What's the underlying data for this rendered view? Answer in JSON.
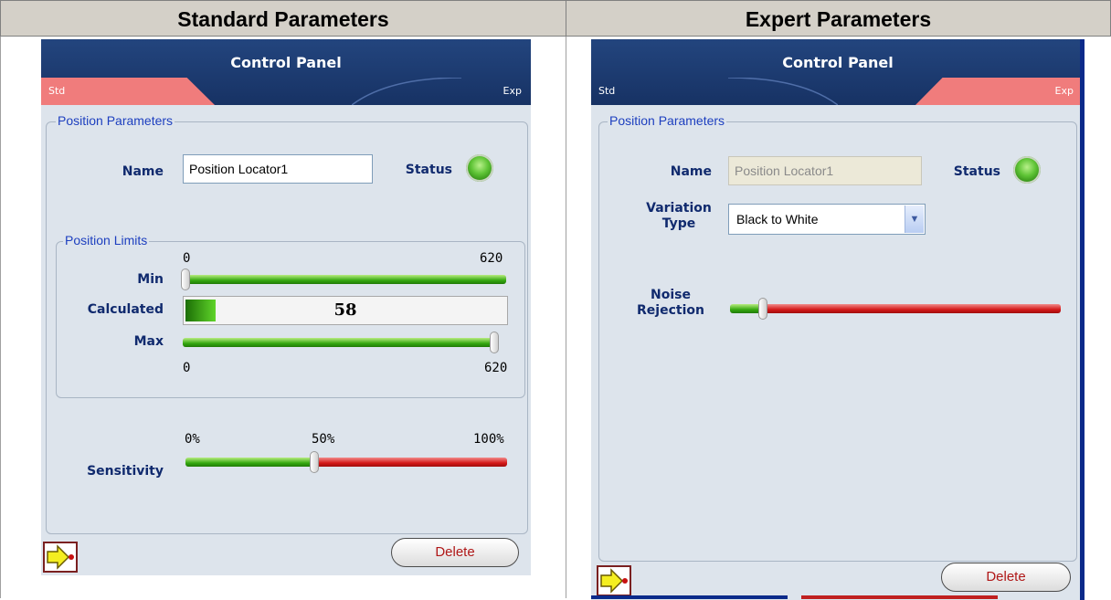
{
  "headers": {
    "standard": "Standard Parameters",
    "expert": "Expert Parameters"
  },
  "standard": {
    "title": "Control Panel",
    "tabs": {
      "std": "Std",
      "exp": "Exp",
      "active": "std"
    },
    "group_title": "Position Parameters",
    "name_label": "Name",
    "name_value": "Position Locator1",
    "status_label": "Status",
    "limits": {
      "title": "Position Limits",
      "min_label": "Min",
      "calculated_label": "Calculated",
      "max_label": "Max",
      "top_ticks": {
        "left": "0",
        "right": "620"
      },
      "bottom_ticks": {
        "left": "0",
        "right": "620"
      },
      "calculated_value": "58",
      "range_max": 620,
      "min_value": 0,
      "max_value": 620
    },
    "sensitivity": {
      "label": "Sensitivity",
      "ticks": {
        "left": "0%",
        "mid": "50%",
        "right": "100%"
      },
      "value_fraction": 0.4
    },
    "delete_label": "Delete"
  },
  "expert": {
    "title": "Control Panel",
    "tabs": {
      "std": "Std",
      "exp": "Exp",
      "active": "exp"
    },
    "group_title": "Position Parameters",
    "name_label": "Name",
    "name_value": "Position Locator1",
    "status_label": "Status",
    "variation_label": "Variation Type",
    "variation_value": "Black to White",
    "noise_label": "Noise Rejection",
    "noise_fraction": 0.1,
    "delete_label": "Delete"
  },
  "colors": {
    "header_bg": "#d4d0c8",
    "panel_bg": "#dde4ec",
    "titlebar": "#23457e",
    "active_tab": "#f07c7c",
    "label": "#102a6e",
    "status_led": "#5fc436"
  }
}
